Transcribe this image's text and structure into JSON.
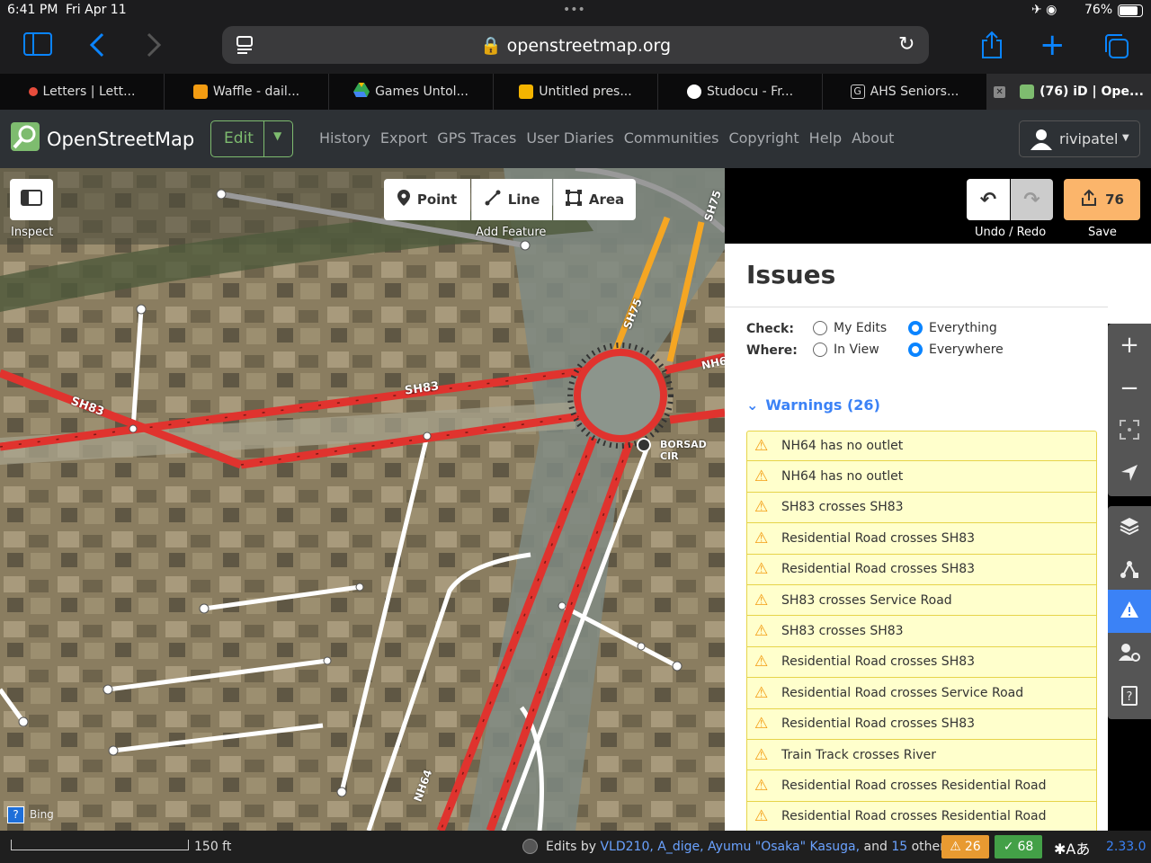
{
  "status": {
    "time": "6:41 PM",
    "date": "Fri Apr 11",
    "battery": "76%",
    "dots": "•••"
  },
  "safari": {
    "url": "openstreetmap.org"
  },
  "tabs": [
    {
      "label": "Letters | Lett...",
      "color": "#e74c3c"
    },
    {
      "label": "Waffle - dail...",
      "color": "#f39c12"
    },
    {
      "label": "Games Untol...",
      "color": "#34a853"
    },
    {
      "label": "Untitled pres...",
      "color": "#f4b400"
    },
    {
      "label": "Studocu - Fr...",
      "color": "#ffffff"
    },
    {
      "label": "AHS Seniors...",
      "color": "#888888"
    },
    {
      "label": "(76) iD | Ope...",
      "color": "#7ebc6f"
    }
  ],
  "osm": {
    "brand": "OpenStreetMap",
    "edit": "Edit",
    "nav": [
      "History",
      "Export",
      "GPS Traces",
      "User Diaries",
      "Communities",
      "Copyright",
      "Help",
      "About"
    ],
    "user": "rivipatel"
  },
  "toolbar": {
    "inspect": "Inspect",
    "point": "Point",
    "line": "Line",
    "area": "Area",
    "add_feature": "Add Feature",
    "undo_redo": "Undo / Redo",
    "save_count": "76",
    "save": "Save"
  },
  "map": {
    "labels": {
      "sh83a": "SH83",
      "sh83b": "SH83",
      "sh75a": "SH75",
      "sh75b": "SH75",
      "nh6": "NH6",
      "nh64": "NH64",
      "borsad": "BORSAD CIR"
    },
    "imagery": "Bing",
    "scale": "150 ft"
  },
  "issues": {
    "title": "Issues",
    "check_label": "Check:",
    "where_label": "Where:",
    "check_options": [
      "My Edits",
      "Everything"
    ],
    "check_selected": 1,
    "where_options": [
      "In View",
      "Everywhere"
    ],
    "where_selected": 1,
    "warnings_header": "Warnings (26)",
    "warnings": [
      "NH64 has no outlet",
      "NH64 has no outlet",
      "SH83 crosses SH83",
      "Residential Road crosses SH83",
      "Residential Road crosses SH83",
      "SH83 crosses Service Road",
      "SH83 crosses SH83",
      "Residential Road crosses SH83",
      "Residential Road crosses Service Road",
      "Residential Road crosses SH83",
      "Train Track crosses River",
      "Residential Road crosses Residential Road",
      "Residential Road crosses Residential Road"
    ]
  },
  "footer": {
    "edits_by": "Edits by",
    "user1": "VLD210,",
    "user2": "A_dige,",
    "user3": "Ayumu \"Osaka\" Kasuga,",
    "and": "and",
    "others_count": "15",
    "others": "others",
    "warnings_count": "26",
    "ok_count": "68",
    "version": "2.33.0"
  },
  "colors": {
    "accent": "#0a84ff",
    "osm_green": "#7ebc6f",
    "warning": "#f39c12",
    "road_red": "#e0332e",
    "road_orange": "#f5a623"
  }
}
